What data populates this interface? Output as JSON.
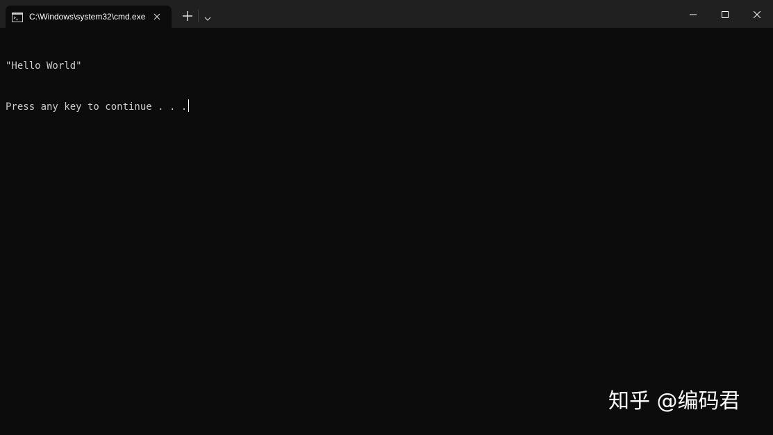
{
  "window": {
    "tab_title": "C:\\Windows\\system32\\cmd.exe",
    "tab_icon": "cmd-icon",
    "new_tab_icon": "plus-icon",
    "dropdown_icon": "chevron-down-icon",
    "minimize_icon": "minimize-icon",
    "maximize_icon": "maximize-icon",
    "close_icon": "close-icon"
  },
  "terminal": {
    "lines": [
      "\"Hello World\"",
      "Press any key to continue . . ."
    ]
  },
  "watermark": {
    "text": "知乎 @编码君"
  },
  "colors": {
    "titlebar": "#202020",
    "terminal_background": "#0c0c0c",
    "terminal_text": "#cccccc"
  }
}
